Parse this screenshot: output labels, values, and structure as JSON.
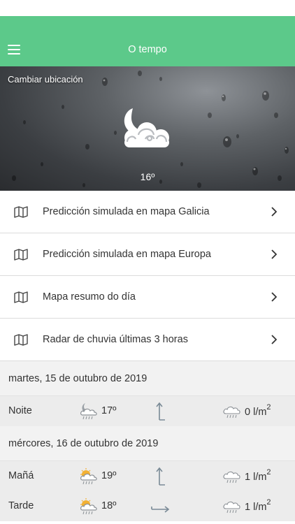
{
  "app_bar": {
    "title": "O tempo",
    "color": "#5cc98a",
    "menu_icon": "hamburger-menu-icon"
  },
  "hero": {
    "change_location": "Cambiar ubicación",
    "weather_icon": "night-cloudy-icon",
    "temperature": "16º"
  },
  "menu": [
    {
      "label": "Predicción simulada en mapa Galicia",
      "icon": "map-icon"
    },
    {
      "label": "Predicción simulada en mapa Europa",
      "icon": "map-icon"
    },
    {
      "label": "Mapa resumo do día",
      "icon": "map-icon"
    },
    {
      "label": "Radar de chuvia últimas 3 horas",
      "icon": "map-icon"
    }
  ],
  "forecast": {
    "day1": {
      "date": "martes, 15 de outubro de 2019",
      "rows": [
        {
          "period": "Noite",
          "temp": "17º",
          "rain": "0 l/m",
          "rain_sup": "2",
          "icon": "night-rain-icon",
          "wind": "wind-arrow-up-icon"
        }
      ]
    },
    "day2": {
      "date": "mércores, 16 de outubro de 2019",
      "rows": [
        {
          "period": "Mañá",
          "temp": "19º",
          "rain": "1 l/m",
          "rain_sup": "2",
          "icon": "sun-cloud-rain-icon",
          "wind": "wind-arrow-up-icon"
        },
        {
          "period": "Tarde",
          "temp": "18º",
          "rain": "1 l/m",
          "rain_sup": "2",
          "icon": "sun-cloud-rain-icon",
          "wind": "wind-arrow-right-icon"
        }
      ]
    }
  }
}
